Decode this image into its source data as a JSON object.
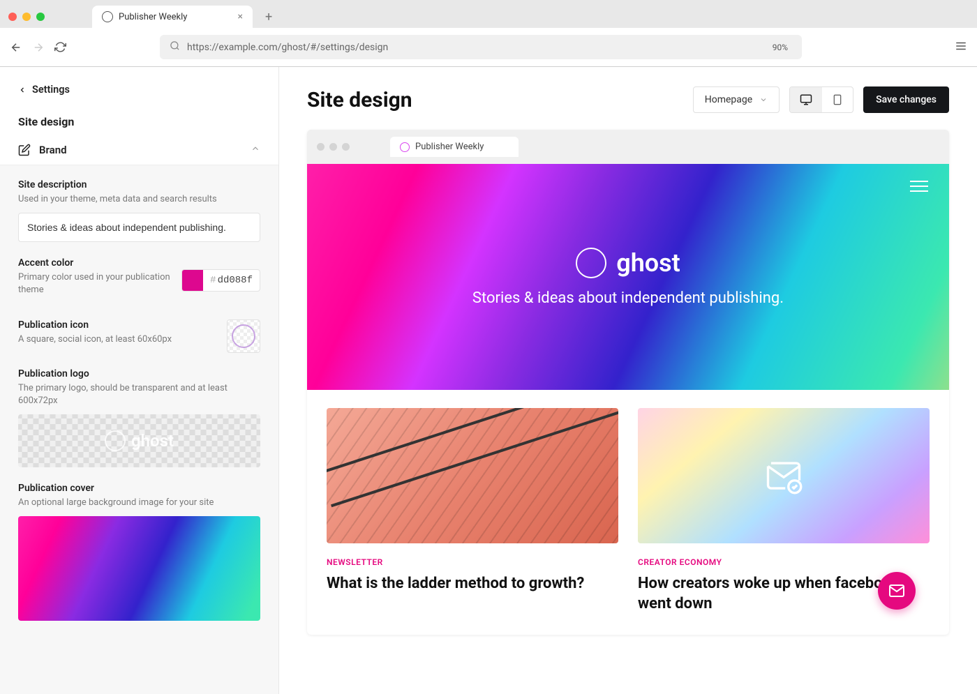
{
  "browser": {
    "tab_title": "Publisher Weekly",
    "url": "https://example.com/ghost/#/settings/design",
    "zoom": "90%"
  },
  "sidebar": {
    "back_label": "Settings",
    "title": "Site design",
    "section_brand": "Brand",
    "fields": {
      "site_description": {
        "label": "Site description",
        "help": "Used in your theme, meta data and search results",
        "value": "Stories & ideas about independent publishing."
      },
      "accent_color": {
        "label": "Accent color",
        "help": "Primary color used in your publication theme",
        "hex": "dd088f"
      },
      "publication_icon": {
        "label": "Publication icon",
        "help": "A square, social icon, at least 60x60px"
      },
      "publication_logo": {
        "label": "Publication logo",
        "help": "The primary logo, should be transparent and at least 600x72px",
        "logo_text": "ghost"
      },
      "publication_cover": {
        "label": "Publication cover",
        "help": "An optional large background image for your site"
      }
    }
  },
  "main": {
    "title": "Site design",
    "dropdown_label": "Homepage",
    "save_label": "Save changes"
  },
  "preview": {
    "tab_title": "Publisher Weekly",
    "hero_brand": "ghost",
    "hero_tagline": "Stories & ideas about independent publishing.",
    "cards": [
      {
        "category": "NEWSLETTER",
        "title": "What is the ladder method to growth?"
      },
      {
        "category": "CREATOR ECONOMY",
        "title": "How creators woke up when facebook went down"
      }
    ]
  },
  "colors": {
    "accent": "#dd088f"
  }
}
